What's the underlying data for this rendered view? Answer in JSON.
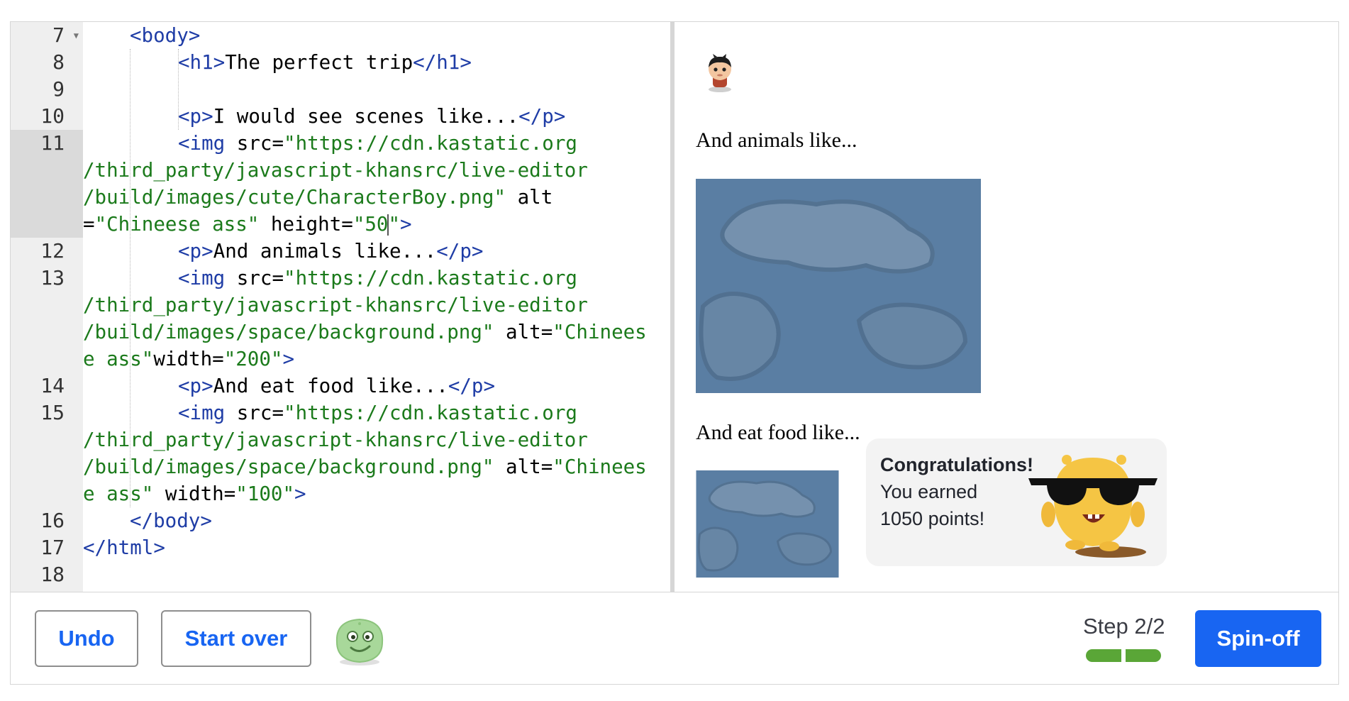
{
  "editor": {
    "line_numbers": [
      "7",
      "8",
      "9",
      "10",
      "11",
      "12",
      "13",
      "14",
      "15",
      "16",
      "17",
      "18"
    ],
    "active_line": "11",
    "code": {
      "l7": {
        "tag": "<body>"
      },
      "l8": {
        "open": "<h1>",
        "text": "The perfect trip",
        "close": "</h1>"
      },
      "l10": {
        "open": "<p>",
        "text": "I would see scenes like...",
        "close": "</p>"
      },
      "l11": {
        "a": "<img",
        "b": " src=",
        "c": "\"https://cdn.kastatic.org",
        "d": "/third_party/javascript-khansrc/live-editor",
        "e": "/build/images/cute/CharacterBoy.png\"",
        "f": " alt",
        "g": "=",
        "h": "\"Chineese ass\"",
        "i": " height=",
        "j1": "\"50",
        "j2": "\"",
        "k": ">"
      },
      "l12": {
        "open": "<p>",
        "text": "And animals like...",
        "close": "</p>"
      },
      "l13": {
        "a": "<img",
        "b": " src=",
        "c": "\"https://cdn.kastatic.org",
        "d": "/third_party/javascript-khansrc/live-editor",
        "e": "/build/images/space/background.png\"",
        "f": " alt=",
        "g": "\"Chinees",
        "h": "e ass\"",
        "i": "width=",
        "j": "\"200\"",
        "k": ">"
      },
      "l14": {
        "open": "<p>",
        "text": "And eat food like...",
        "close": "</p>"
      },
      "l15": {
        "a": "<img",
        "b": " src=",
        "c": "\"https://cdn.kastatic.org",
        "d": "/third_party/javascript-khansrc/live-editor",
        "e": "/build/images/space/background.png\"",
        "f": " alt=",
        "g": "\"Chinees",
        "h": "e ass\"",
        "i": " width=",
        "j": "\"100\"",
        "k": ">"
      },
      "l16": {
        "tag": "</body>"
      },
      "l17": {
        "tag": "</html>"
      }
    }
  },
  "preview": {
    "animals_text": "And animals like...",
    "food_text": "And eat food like..."
  },
  "congrats": {
    "title": "Congratulations!",
    "line1": "You earned",
    "line2": "1050 points!"
  },
  "toolbar": {
    "undo_label": "Undo",
    "start_over_label": "Start over",
    "step_label": "Step 2/2",
    "step_progress": 1.0,
    "spinoff_label": "Spin-off"
  },
  "colors": {
    "accent": "#1865f2",
    "progress": "#5aa637",
    "tag": "#1f3da6",
    "string": "#1b7a1b"
  }
}
